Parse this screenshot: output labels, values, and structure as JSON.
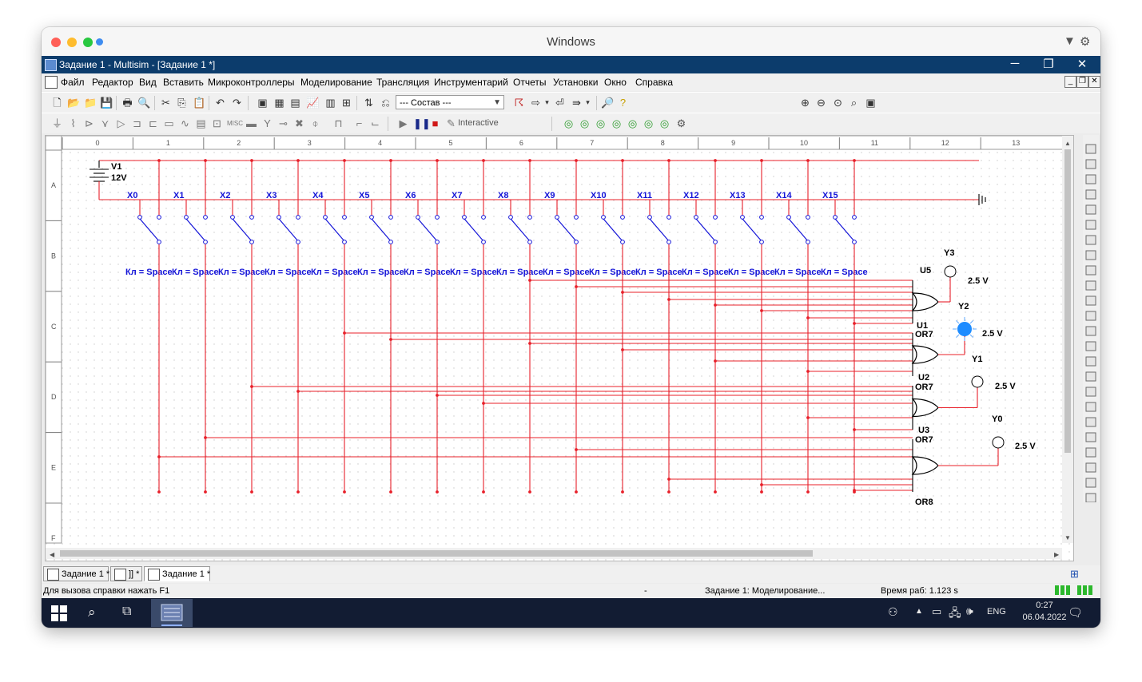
{
  "os_window": {
    "title": "Windows"
  },
  "app": {
    "title": "Задание 1 - Multisim - [Задание 1 *]"
  },
  "menu": [
    "Файл",
    "Редактор",
    "Вид",
    "Вставить",
    "Микроконтроллеры",
    "Моделирование",
    "Трансляция",
    "Инструментарий",
    "Отчеты",
    "Установки",
    "Окно",
    "Справка"
  ],
  "toolbar": {
    "combo_value": "--- Состав ---",
    "interactive_label": "Interactive"
  },
  "ruler": {
    "columns": [
      "0",
      "1",
      "2",
      "3",
      "4",
      "5",
      "6",
      "7",
      "8",
      "9",
      "10",
      "11",
      "12",
      "13"
    ],
    "rows": [
      "A",
      "B",
      "C",
      "D",
      "E",
      "F"
    ]
  },
  "schematic": {
    "source_name": "V1",
    "source_value": "12V",
    "switch_names": [
      "X0",
      "X1",
      "X2",
      "X3",
      "X4",
      "X5",
      "X6",
      "X7",
      "X8",
      "X9",
      "X10",
      "X11",
      "X12",
      "X13",
      "X14",
      "X15"
    ],
    "key_label": "Кл = Space",
    "gates": [
      {
        "ref": "U5",
        "type": "OR7"
      },
      {
        "ref": "U1",
        "type": "OR7"
      },
      {
        "ref": "U2",
        "type": "OR7"
      },
      {
        "ref": "U3",
        "type": "OR8"
      }
    ],
    "probes": [
      {
        "name": "Y3",
        "voltage": "2.5 V",
        "lit": false
      },
      {
        "name": "Y2",
        "voltage": "2.5 V",
        "lit": true
      },
      {
        "name": "Y1",
        "voltage": "2.5 V",
        "lit": false
      },
      {
        "name": "Y0",
        "voltage": "2.5 V",
        "lit": false
      }
    ]
  },
  "tabs": [
    "Задание 1 *",
    "]] *",
    "Задание 1 *"
  ],
  "status": {
    "help": "Для вызова справки нажать F1",
    "dash": "-",
    "sim": "Задание 1: Моделирование...",
    "time": "Время раб: 1.123 s"
  },
  "taskbar": {
    "lang": "ENG",
    "time": "0:27",
    "date": "06.04.2022"
  },
  "colors": {
    "wire": "#e8202a",
    "net_label": "#1414d8",
    "probe_lit": "#1e8cff",
    "titlebar": "#0c3c6c",
    "taskbar": "#121c33"
  }
}
